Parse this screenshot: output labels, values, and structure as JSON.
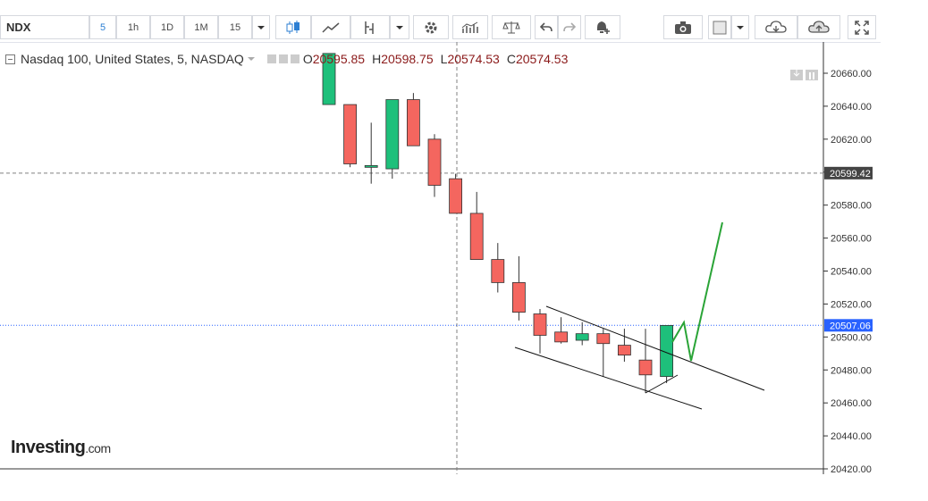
{
  "toolbar": {
    "symbol": "NDX",
    "intervals": [
      "5",
      "1h",
      "1D",
      "1M",
      "15"
    ],
    "active_interval": "5"
  },
  "legend": {
    "title": "Nasdaq 100, United States, 5, NASDAQ",
    "open_label": "O",
    "open": "20595.85",
    "high_label": "H",
    "high": "20598.75",
    "low_label": "L",
    "low": "20574.53",
    "close_label": "C",
    "close": "20574.53"
  },
  "logo": {
    "brand": "Investing",
    "suffix": ".com"
  },
  "chart_data": {
    "type": "candlestick",
    "ylim": [
      20420,
      20672
    ],
    "y_ticks": [
      "20660.00",
      "20640.00",
      "20620.00",
      "20600.00",
      "20580.00",
      "20560.00",
      "20540.00",
      "20520.00",
      "20500.00",
      "20480.00",
      "20460.00",
      "20440.00",
      "20420.00"
    ],
    "crosshair_label": "20599.42",
    "last_price_label": "20507.06",
    "candles": [
      {
        "o": 20641,
        "h": 20672,
        "l": 20641,
        "c": 20672
      },
      {
        "o": 20641,
        "h": 20641,
        "l": 20603,
        "c": 20605
      },
      {
        "o": 20603,
        "h": 20630,
        "l": 20593,
        "c": 20604
      },
      {
        "o": 20602,
        "h": 20644,
        "l": 20596,
        "c": 20644
      },
      {
        "o": 20644,
        "h": 20648,
        "l": 20616,
        "c": 20616
      },
      {
        "o": 20620,
        "h": 20623,
        "l": 20585,
        "c": 20592
      },
      {
        "o": 20596,
        "h": 20599,
        "l": 20575,
        "c": 20575
      },
      {
        "o": 20575,
        "h": 20588,
        "l": 20547,
        "c": 20547
      },
      {
        "o": 20547,
        "h": 20557,
        "l": 20527,
        "c": 20533
      },
      {
        "o": 20533,
        "h": 20549,
        "l": 20510,
        "c": 20515
      },
      {
        "o": 20514,
        "h": 20517,
        "l": 20490,
        "c": 20501
      },
      {
        "o": 20503,
        "h": 20512,
        "l": 20496,
        "c": 20497
      },
      {
        "o": 20498,
        "h": 20509,
        "l": 20495,
        "c": 20502
      },
      {
        "o": 20502,
        "h": 20505,
        "l": 20476,
        "c": 20496
      },
      {
        "o": 20495,
        "h": 20505,
        "l": 20485,
        "c": 20489
      },
      {
        "o": 20486,
        "h": 20505,
        "l": 20466,
        "c": 20477
      },
      {
        "o": 20476,
        "h": 20507,
        "l": 20472,
        "c": 20507
      }
    ]
  },
  "colors": {
    "up": "#1ec07b",
    "down": "#f4665f",
    "wick": "#333333",
    "projection": "#2aa437",
    "crosshair": "#808080",
    "last_price": "#2962ff",
    "axis_label_bg": "#444444",
    "last_label_bg": "#2962ff"
  },
  "icons": [
    "dropdown-icon",
    "candles-icon",
    "line-chart-icon",
    "indicator-icon",
    "settings-icon",
    "study-icon",
    "compare-icon",
    "undo-icon",
    "redo-icon",
    "alert-icon",
    "camera-icon",
    "color-icon",
    "cloud-download-icon",
    "cloud-upload-icon",
    "fullscreen-icon"
  ]
}
